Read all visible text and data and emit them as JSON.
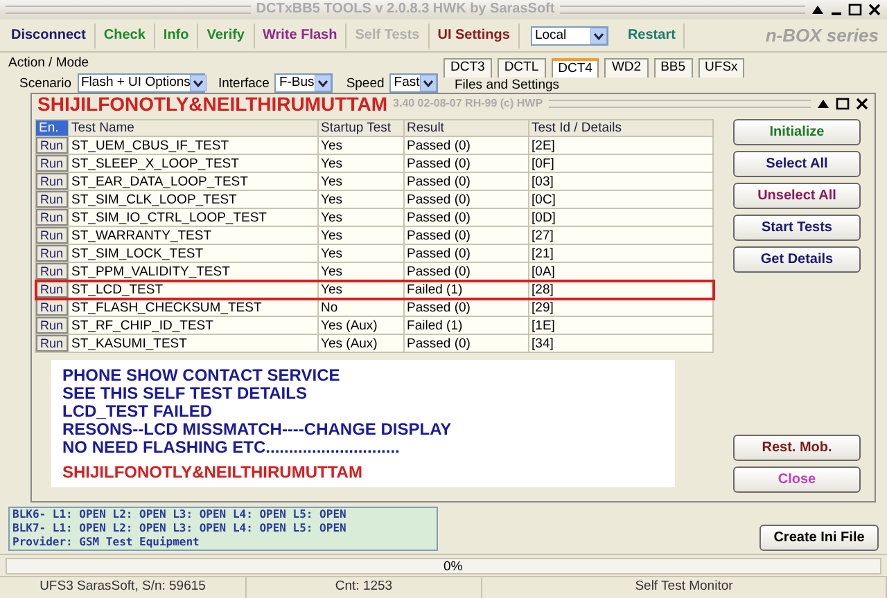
{
  "window": {
    "title": "DCTxBB5 TOOLS v 2.0.8.3 HWK by SarasSoft"
  },
  "toolbar": [
    {
      "kind": "button",
      "label": "Disconnect",
      "color": "#1a1a70",
      "disabled": false
    },
    {
      "kind": "button",
      "label": "Check",
      "color": "#1e8a2a",
      "disabled": false
    },
    {
      "kind": "button",
      "label": "Info",
      "color": "#1e8a2a",
      "disabled": false
    },
    {
      "kind": "button",
      "label": "Verify",
      "color": "#1e8a2a",
      "disabled": false
    },
    {
      "kind": "button",
      "label": "Write Flash",
      "color": "#8a2a8a",
      "disabled": false
    },
    {
      "kind": "button",
      "label": "Self Tests",
      "disabled": true
    },
    {
      "kind": "button",
      "label": "UI Settings",
      "color": "#8a1a1a",
      "disabled": false
    },
    {
      "kind": "select",
      "label": "Local"
    },
    {
      "kind": "button",
      "label": "Restart",
      "color": "#1a7a6a",
      "disabled": false
    }
  ],
  "logo": "n-BOX series",
  "action_mode": {
    "title": "Action / Mode",
    "scenario_label": "Scenario",
    "scenario": "Flash + UI Options",
    "interface_label": "Interface",
    "interface": "F-Bus",
    "speed_label": "Speed",
    "speed": "Fast"
  },
  "tabs": [
    {
      "label": "DCT3",
      "selected": false
    },
    {
      "label": "DCTL",
      "selected": false
    },
    {
      "label": "DCT4",
      "selected": true
    },
    {
      "label": "WD2",
      "selected": false
    },
    {
      "label": "BB5",
      "selected": false
    },
    {
      "label": "UFSx",
      "selected": false
    }
  ],
  "files_group": "Files and Settings",
  "log": [
    "BLK6- L1: OPEN L2: OPEN L3: OPEN L4: OPEN L5: OPEN",
    "BLK7- L1: OPEN L2: OPEN L3: OPEN L4: OPEN L5: OPEN",
    "Provider: GSM Test Equipment"
  ],
  "create_ini_button": "Create Ini File",
  "progress": {
    "label": "0%",
    "level": 0
  },
  "status_bar": [
    "UFS3 SarasSoft, S/n: 59615",
    "Cnt: 1253",
    "Self Test Monitor"
  ],
  "dialog": {
    "banner": "SHIJILFONOTLY&NEILTHIRUMUTTAM",
    "title": "3.40 02-08-07 RH-99 (c) HWP",
    "columns": [
      "En.",
      "Test Name",
      "Startup Test",
      "Result",
      "Test Id / Details"
    ],
    "rows": [
      {
        "action": "Run",
        "name": "ST_UEM_CBUS_IF_TEST",
        "startup": "Yes",
        "result": "Passed (0)",
        "id": "[2E]",
        "highlighted": false
      },
      {
        "action": "Run",
        "name": "ST_SLEEP_X_LOOP_TEST",
        "startup": "Yes",
        "result": "Passed (0)",
        "id": "[0F]",
        "highlighted": false
      },
      {
        "action": "Run",
        "name": "ST_EAR_DATA_LOOP_TEST",
        "startup": "Yes",
        "result": "Passed (0)",
        "id": "[03]",
        "highlighted": false
      },
      {
        "action": "Run",
        "name": "ST_SIM_CLK_LOOP_TEST",
        "startup": "Yes",
        "result": "Passed (0)",
        "id": "[0C]",
        "highlighted": false
      },
      {
        "action": "Run",
        "name": "ST_SIM_IO_CTRL_LOOP_TEST",
        "startup": "Yes",
        "result": "Passed (0)",
        "id": "[0D]",
        "highlighted": false
      },
      {
        "action": "Run",
        "name": "ST_WARRANTY_TEST",
        "startup": "Yes",
        "result": "Passed (0)",
        "id": "[27]",
        "highlighted": false
      },
      {
        "action": "Run",
        "name": "ST_SIM_LOCK_TEST",
        "startup": "Yes",
        "result": "Passed (0)",
        "id": "[21]",
        "highlighted": false
      },
      {
        "action": "Run",
        "name": "ST_PPM_VALIDITY_TEST",
        "startup": "Yes",
        "result": "Passed (0)",
        "id": "[0A]",
        "highlighted": false
      },
      {
        "action": "Run",
        "name": "ST_LCD_TEST",
        "startup": "Yes",
        "result": "Failed (1)",
        "id": "[28]",
        "highlighted": true
      },
      {
        "action": "Run",
        "name": "ST_FLASH_CHECKSUM_TEST",
        "startup": "No",
        "result": "Passed (0)",
        "id": "[29]",
        "highlighted": false
      },
      {
        "action": "Run",
        "name": "ST_RF_CHIP_ID_TEST",
        "startup": "Yes (Aux)",
        "result": "Failed (1)",
        "id": "[1E]",
        "highlighted": false
      },
      {
        "action": "Run",
        "name": "ST_KASUMI_TEST",
        "startup": "Yes (Aux)",
        "result": "Passed (0)",
        "id": "[34]",
        "highlighted": false
      }
    ],
    "buttons": [
      {
        "label": "Initialize",
        "color": "#1e7a2a"
      },
      {
        "label": "Select All",
        "color": "#1a1a70"
      },
      {
        "label": "Unselect All",
        "color": "#8a1a5a"
      },
      {
        "label": "Start Tests",
        "color": "#1a1a70"
      },
      {
        "label": "Get Details",
        "color": "#1a1a70"
      }
    ],
    "bottom_buttons": [
      {
        "label": "Rest. Mob.",
        "color": "#7a1a1a"
      },
      {
        "label": "Close",
        "color": "#c040c0"
      }
    ],
    "message": {
      "lines": [
        "PHONE SHOW CONTACT SERVICE",
        "SEE THIS SELF TEST DETAILS",
        "LCD_TEST FAILED",
        "RESONS--LCD MISSMATCH----CHANGE DISPLAY",
        "NO NEED FLASHING ETC............................."
      ],
      "signature": "SHIJILFONOTLY&NEILTHIRUMUTTAM"
    }
  }
}
